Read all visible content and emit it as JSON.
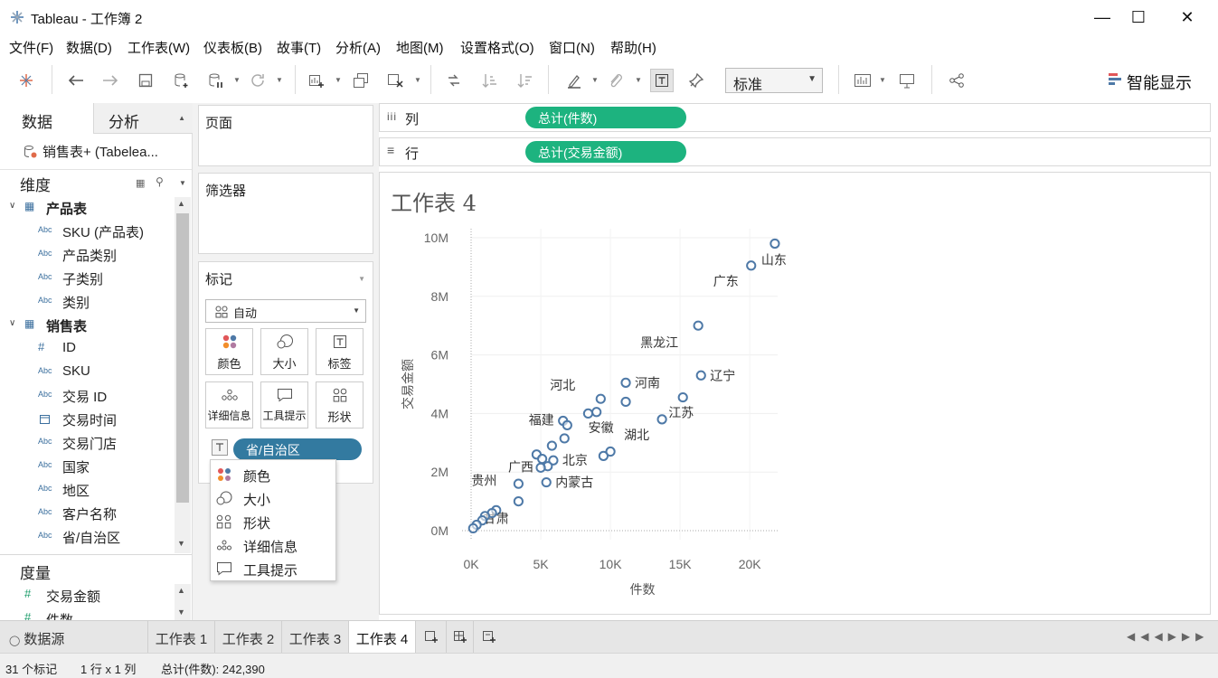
{
  "window": {
    "title": "Tableau - 工作簿 2"
  },
  "menu": [
    "文件(F)",
    "数据(D)",
    "工作表(W)",
    "仪表板(B)",
    "故事(T)",
    "分析(A)",
    "地图(M)",
    "设置格式(O)",
    "窗口(N)",
    "帮助(H)"
  ],
  "toolbar": {
    "fit_value": "标准",
    "show_me_label": "智能显示"
  },
  "left_panel": {
    "tabs": {
      "data": "数据",
      "analytics": "分析"
    },
    "datasource": "销售表+ (Tabelea...",
    "dimensions_label": "维度",
    "groups": [
      {
        "name": "产品表",
        "fields": [
          {
            "type": "Abc",
            "name": "SKU (产品表)"
          },
          {
            "type": "Abc",
            "name": "产品类别"
          },
          {
            "type": "Abc",
            "name": "子类别"
          },
          {
            "type": "Abc",
            "name": "类别"
          }
        ]
      },
      {
        "name": "销售表",
        "fields": [
          {
            "type": "#",
            "name": "ID"
          },
          {
            "type": "Abc",
            "name": "SKU"
          },
          {
            "type": "Abc",
            "name": "交易 ID"
          },
          {
            "type": "date",
            "name": "交易时间"
          },
          {
            "type": "Abc",
            "name": "交易门店"
          },
          {
            "type": "Abc",
            "name": "国家"
          },
          {
            "type": "Abc",
            "name": "地区"
          },
          {
            "type": "Abc",
            "name": "客户名称"
          },
          {
            "type": "Abc",
            "name": "省/自治区"
          }
        ]
      }
    ],
    "measures_label": "度量",
    "measures": [
      "交易金额",
      "件数"
    ]
  },
  "cards": {
    "pages_label": "页面",
    "filters_label": "筛选器",
    "marks_label": "标记",
    "mark_type": "自动",
    "mark_buttons": [
      "颜色",
      "大小",
      "标签",
      "详细信息",
      "工具提示",
      "形状"
    ],
    "marks_pill": "省/自治区",
    "dropdown_items": [
      "颜色",
      "大小",
      "形状",
      "详细信息",
      "工具提示"
    ]
  },
  "shelves": {
    "columns_label": "列",
    "columns_pill": "总计(件数)",
    "rows_label": "行",
    "rows_pill": "总计(交易金额)"
  },
  "sheet_title": "工作表 4",
  "chart_data": {
    "type": "scatter",
    "xlabel": "件数",
    "ylabel": "交易金额",
    "xlim": [
      0,
      22000
    ],
    "ylim": [
      0,
      10000000
    ],
    "x_ticks": [
      "0K",
      "5K",
      "10K",
      "15K",
      "20K"
    ],
    "y_ticks": [
      "0M",
      "2M",
      "4M",
      "6M",
      "8M",
      "10M"
    ],
    "mark_color": "#4e79a7",
    "points": [
      {
        "x": 21800,
        "y": 9800000,
        "label": "山东"
      },
      {
        "x": 20100,
        "y": 9050000,
        "label": "广东"
      },
      {
        "x": 16300,
        "y": 7000000,
        "label": "黑龙江"
      },
      {
        "x": 16500,
        "y": 5300000,
        "label": "辽宁"
      },
      {
        "x": 11100,
        "y": 5050000,
        "label": "河南"
      },
      {
        "x": 9300,
        "y": 4500000,
        "label": "河北"
      },
      {
        "x": 11100,
        "y": 4400000,
        "label": ""
      },
      {
        "x": 15200,
        "y": 4550000,
        "label": "江苏"
      },
      {
        "x": 13700,
        "y": 3800000,
        "label": "湖北"
      },
      {
        "x": 9000,
        "y": 4050000,
        "label": "安徽"
      },
      {
        "x": 8400,
        "y": 4000000,
        "label": ""
      },
      {
        "x": 6600,
        "y": 3750000,
        "label": "福建"
      },
      {
        "x": 6900,
        "y": 3600000,
        "label": ""
      },
      {
        "x": 6700,
        "y": 3150000,
        "label": ""
      },
      {
        "x": 5800,
        "y": 2900000,
        "label": ""
      },
      {
        "x": 10000,
        "y": 2700000,
        "label": ""
      },
      {
        "x": 9500,
        "y": 2550000,
        "label": ""
      },
      {
        "x": 4700,
        "y": 2600000,
        "label": ""
      },
      {
        "x": 5100,
        "y": 2450000,
        "label": ""
      },
      {
        "x": 5900,
        "y": 2400000,
        "label": "北京"
      },
      {
        "x": 5500,
        "y": 2200000,
        "label": ""
      },
      {
        "x": 5000,
        "y": 2150000,
        "label": "广西"
      },
      {
        "x": 5400,
        "y": 1650000,
        "label": "内蒙古"
      },
      {
        "x": 3400,
        "y": 1600000,
        "label": ""
      },
      {
        "x": 3400,
        "y": 1000000,
        "label": "贵州"
      },
      {
        "x": 1800,
        "y": 700000,
        "label": "甘肃"
      },
      {
        "x": 1500,
        "y": 600000,
        "label": ""
      },
      {
        "x": 1000,
        "y": 500000,
        "label": ""
      },
      {
        "x": 800,
        "y": 350000,
        "label": ""
      },
      {
        "x": 400,
        "y": 200000,
        "label": ""
      },
      {
        "x": 150,
        "y": 80000,
        "label": ""
      }
    ]
  },
  "bottom_tabs": {
    "datasource": "数据源",
    "sheets": [
      "工作表 1",
      "工作表 2",
      "工作表 3",
      "工作表 4"
    ]
  },
  "status": {
    "marks": "31 个标记",
    "rows_cols": "1 行 x 1 列",
    "sum": "总计(件数): 242,390"
  },
  "colors": {
    "pill_green": "#1db37f",
    "pill_blue": "#337aa0",
    "accent": "#4e79a7"
  }
}
